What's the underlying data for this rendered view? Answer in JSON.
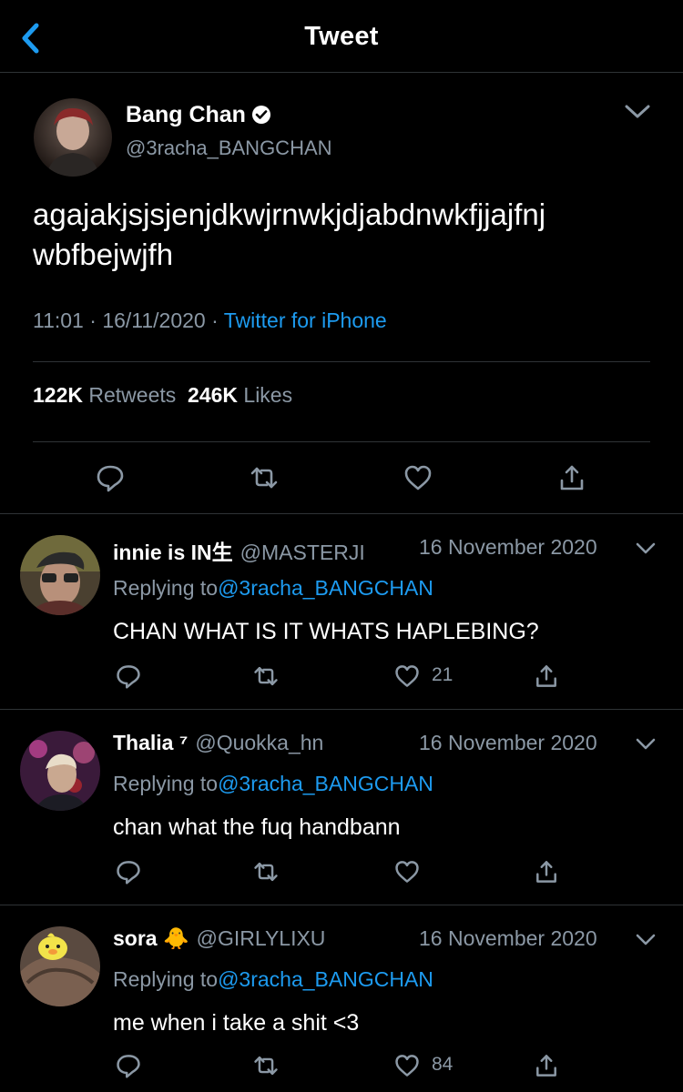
{
  "header": {
    "title": "Tweet"
  },
  "main_tweet": {
    "name": "Bang Chan",
    "handle": "@3racha_BANGCHAN",
    "text": "agajakjsjsjenjdkwjrnwkjdjabdnwkfjjajfnj wbfbejwjfh",
    "time": "11:01",
    "date": "16/11/2020",
    "source": "Twitter for iPhone",
    "retweets_count": "122K",
    "retweets_label": "Retweets",
    "likes_count": "246K",
    "likes_label": "Likes"
  },
  "replies": [
    {
      "name": "innie is IN生",
      "handle": "@MASTERJI",
      "date": "16 November 2020",
      "replying_label": "Replying to",
      "replying_to": "@3racha_BANGCHAN",
      "text": "CHAN WHAT IS IT WHATS HAPLEBING?",
      "likes": "21"
    },
    {
      "name": "Thalia ⁷",
      "handle": "@Quokka_hn",
      "date": "16 November 2020",
      "replying_label": "Replying to",
      "replying_to": "@3racha_BANGCHAN",
      "text": "chan what the fuq handbann",
      "likes": ""
    },
    {
      "name": "sora 🐥",
      "handle": "@GIRLYLIXU",
      "date": "16 November 2020",
      "replying_label": "Replying to",
      "replying_to": "@3racha_BANGCHAN",
      "text": "me when i take a shit <3",
      "likes": "84"
    }
  ],
  "colors": {
    "background": "#000000",
    "accent": "#1d9bf0",
    "secondary_text": "#8b98a5",
    "divider": "#2f3336"
  }
}
